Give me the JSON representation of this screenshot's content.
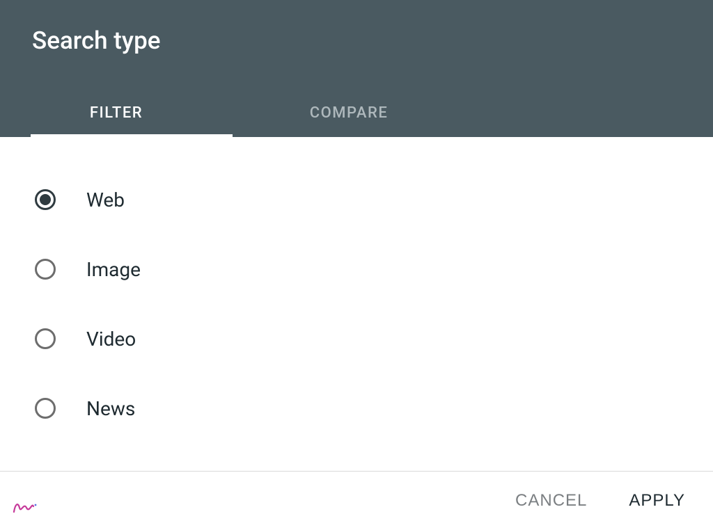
{
  "header": {
    "title": "Search type"
  },
  "tabs": {
    "filter": "FILTER",
    "compare": "COMPARE"
  },
  "options": {
    "web": "Web",
    "image": "Image",
    "video": "Video",
    "news": "News"
  },
  "footer": {
    "cancel": "CANCEL",
    "apply": "APPLY"
  }
}
